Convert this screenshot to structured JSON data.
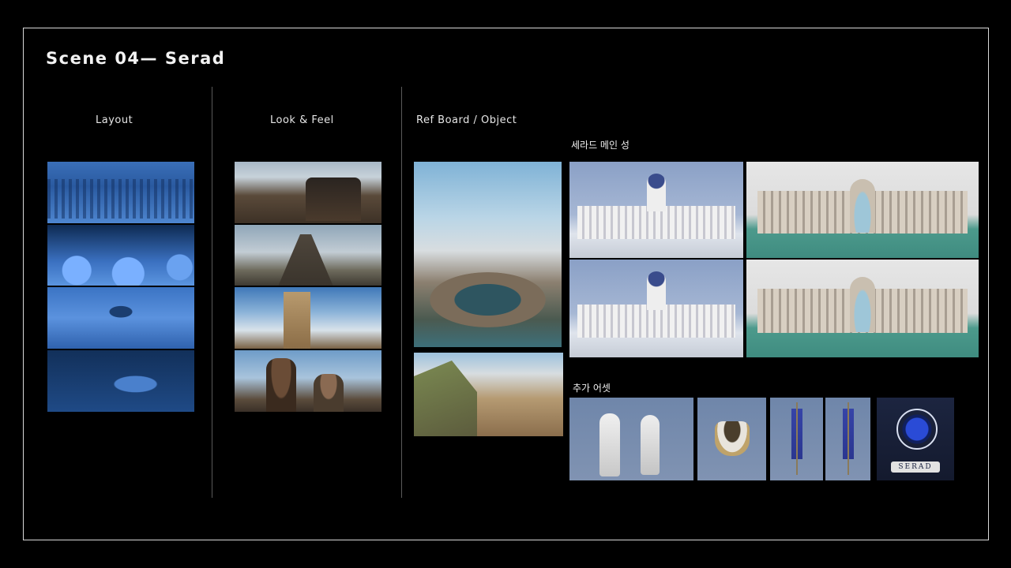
{
  "title": "Scene 04— Serad",
  "columns": {
    "layout": "Layout",
    "look_feel": "Look & Feel",
    "ref_board": "Ref Board / Object"
  },
  "sections": {
    "main_castle": "세라드 메인 성",
    "extra_assets": "추가 어셋"
  },
  "emblem_text": "SERAD"
}
